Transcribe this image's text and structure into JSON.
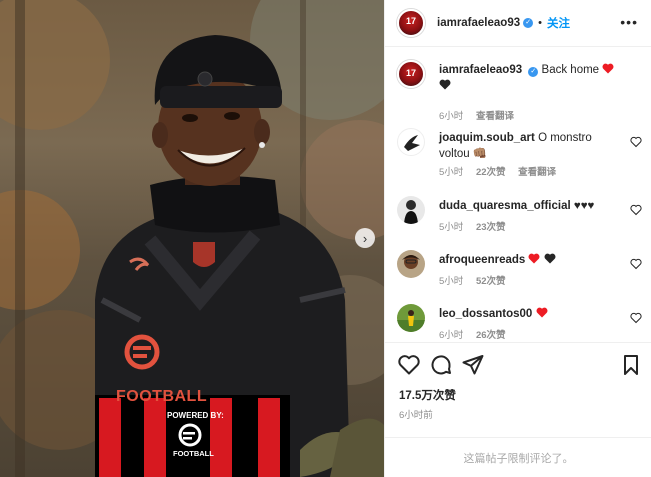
{
  "post": {
    "username": "iamrafaeleao93",
    "follow_label": "关注",
    "separator": "•",
    "more_label": "•••",
    "caption_text": "Back home",
    "caption_time": "6小时",
    "caption_translate": "查看翻译",
    "avatar_monogram": "17"
  },
  "comments": [
    {
      "username": "joaquim.soub_art",
      "text": "O monstro voltou 👊🏽",
      "time": "5小时",
      "likes": "22次赞",
      "reply": "查看翻译"
    },
    {
      "username": "duda_quaresma_official",
      "text": "♥♥♥",
      "time": "5小时",
      "likes": "23次赞"
    },
    {
      "username": "afroqueenreads",
      "text": "",
      "time": "5小时",
      "likes": "52次赞"
    },
    {
      "username": "leo_dossantos00",
      "text": "",
      "time": "6小时",
      "likes": "26次赞"
    }
  ],
  "footer": {
    "likes_count": "17.5万次赞",
    "posted": "6小时前",
    "comments_restricted": "这篇帖子限制评论了。"
  },
  "photo": {
    "sponsor_label": "POWERED BY:",
    "sponsor_brand": "FOOTBALL",
    "shirt_brand": "FOOTBALL",
    "next_label": "›"
  },
  "colors": {
    "link_blue": "#0095f6",
    "heart_red": "#ed1c24",
    "heart_black": "#262626",
    "milan_red": "#d71920"
  }
}
